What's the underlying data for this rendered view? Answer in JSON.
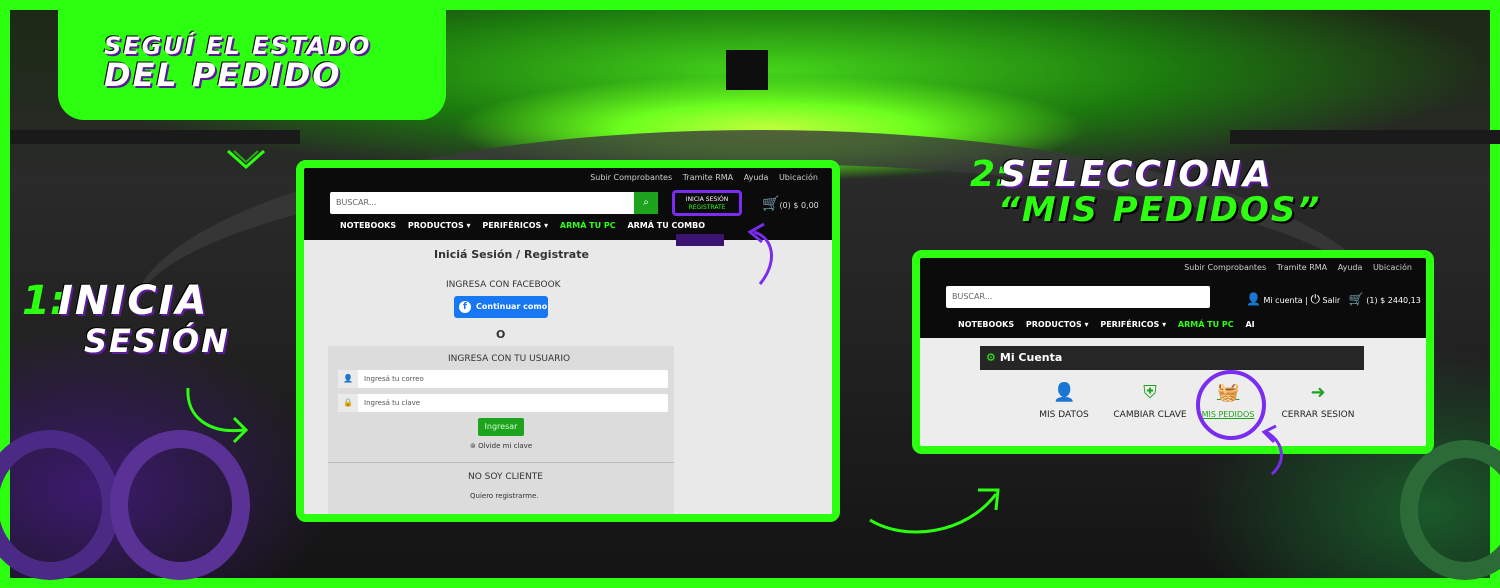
{
  "banner": {
    "title_line1": "SEGUÍ EL ESTADO",
    "title_line2": "DEL PEDIDO",
    "step1_number": "1:",
    "step1_line1": "INICIA",
    "step1_line2": "SESIÓN",
    "step2_number": "2:",
    "step2_line1": "SELECCIONA",
    "step2_line2": "“MIS PEDIDOS”",
    "accent_color": "#2cff10",
    "highlight_color": "#7a2cf0"
  },
  "screen1": {
    "top_links": [
      "Subir Comprobantes",
      "Tramite RMA",
      "Ayuda",
      "Ubicación"
    ],
    "search_placeholder": "BUSCAR...",
    "login_line1": "INICIA SESIÓN",
    "login_line2": "REGISTRATE",
    "cart_text": "(0) $ 0,00",
    "nav": [
      "NOTEBOOKS",
      "PRODUCTOS ▾",
      "PERIFÉRICOS ▾",
      "ARMÁ TU PC",
      "ARMÁ TU COMBO"
    ],
    "page_title": "Iniciá Sesión / Registrate",
    "facebook_heading": "INGRESA CON FACEBOOK",
    "facebook_button": "Continuar como",
    "or_text": "O",
    "user_heading": "INGRESA CON TU USUARIO",
    "email_placeholder": "Ingresá tu correo",
    "password_placeholder": "Ingresá tu clave",
    "submit_button": "Ingresar",
    "forgot_link": "Olvide mi clave",
    "not_client_heading": "NO SOY CLIENTE",
    "register_link": "Quiero registrarme."
  },
  "screen2": {
    "top_links": [
      "Subir Comprobantes",
      "Tramite RMA",
      "Ayuda",
      "Ubicación"
    ],
    "search_placeholder": "BUSCAR...",
    "account_link": "Mi cuenta",
    "logout_link": "Salir",
    "cart_text": "(1) $ 2440,13",
    "nav": [
      "NOTEBOOKS",
      "PRODUCTOS ▾",
      "PERIFÉRICOS ▾",
      "ARMÁ TU PC",
      "AI"
    ],
    "section_title": "Mi Cuenta",
    "options": [
      "MIS DATOS",
      "CAMBIAR CLAVE",
      "MIS PEDIDOS",
      "CERRAR SESION"
    ]
  }
}
